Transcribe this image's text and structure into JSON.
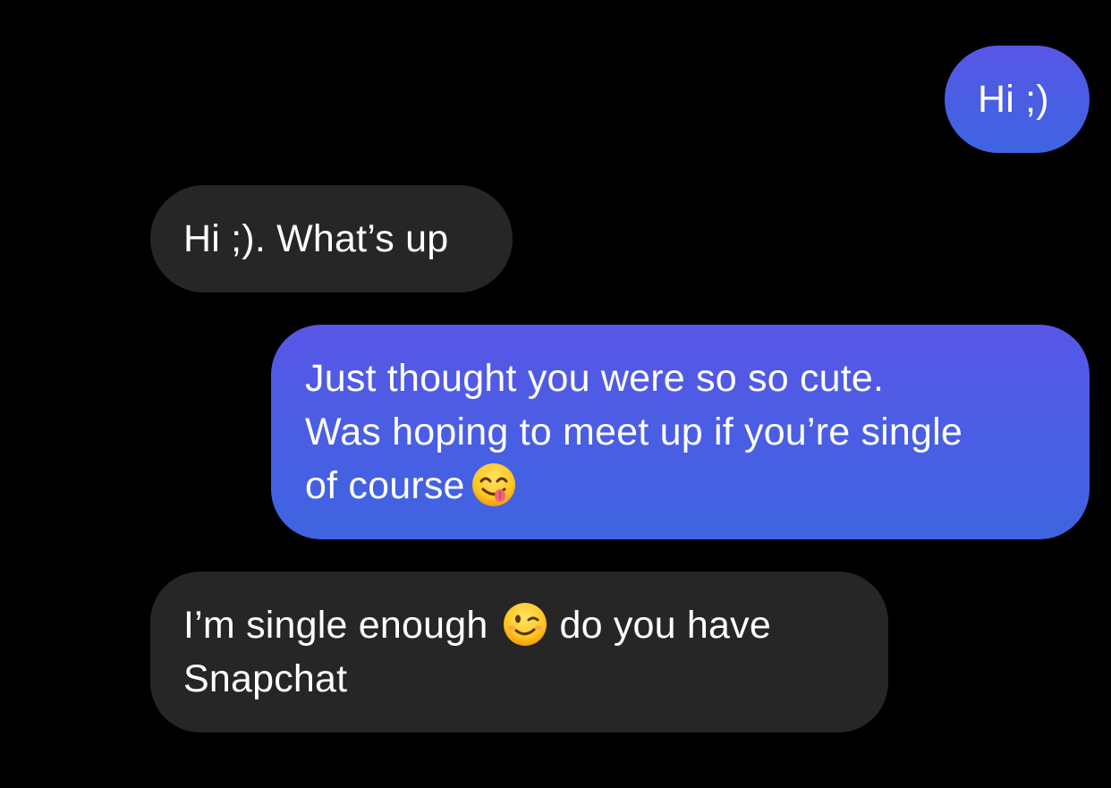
{
  "messages": [
    {
      "direction": "outgoing",
      "lines": [
        "Hi ;)"
      ]
    },
    {
      "direction": "incoming",
      "lines": [
        "Hi ;). What’s up"
      ]
    },
    {
      "direction": "outgoing",
      "lines": [
        "Just thought you were so so cute.",
        "Was hoping to meet up if you’re single",
        "of course"
      ],
      "emoji_after_line_3": "face-savoring-food-icon"
    },
    {
      "direction": "incoming",
      "line1_before_emoji": "I’m single enough",
      "emoji": "winking-face-icon",
      "line1_after_emoji": "do you have",
      "line2": "Snapchat"
    }
  ],
  "colors": {
    "background": "#000000",
    "incoming_bubble": "#262626",
    "outgoing_bubble_top": "#5856e6",
    "outgoing_bubble_bottom": "#3f64e0",
    "text": "#ffffff"
  }
}
